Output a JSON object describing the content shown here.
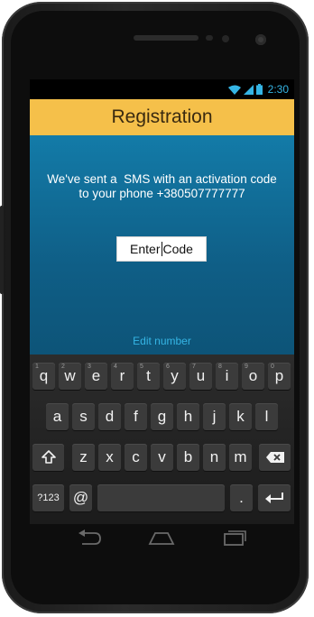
{
  "status": {
    "time": "2:30",
    "icons": [
      "wifi-icon",
      "signal-icon",
      "battery-icon"
    ]
  },
  "header": {
    "title": "Registration"
  },
  "main": {
    "message_line1": "We've sent a  SMS with an activation code",
    "message_line2": "to your phone +380507777777",
    "code_input": {
      "value_before_cursor": "Enter",
      "value_after_cursor": "Code"
    },
    "edit_number_link": "Edit number"
  },
  "keyboard": {
    "row1": [
      {
        "label": "q",
        "hint": "1"
      },
      {
        "label": "w",
        "hint": "2"
      },
      {
        "label": "e",
        "hint": "3"
      },
      {
        "label": "r",
        "hint": "4"
      },
      {
        "label": "t",
        "hint": "5"
      },
      {
        "label": "y",
        "hint": "6"
      },
      {
        "label": "u",
        "hint": "7"
      },
      {
        "label": "i",
        "hint": "8"
      },
      {
        "label": "o",
        "hint": "9"
      },
      {
        "label": "p",
        "hint": "0"
      }
    ],
    "row2": [
      "a",
      "s",
      "d",
      "f",
      "g",
      "h",
      "j",
      "k",
      "l"
    ],
    "row3": [
      "z",
      "x",
      "c",
      "v",
      "b",
      "n",
      "m"
    ],
    "row4": {
      "symbols": "?123",
      "at": "@",
      "period": "."
    }
  },
  "colors": {
    "accent": "#35b5e5",
    "header_bg": "#f5c04a",
    "content_bg": "#0f5e86"
  }
}
